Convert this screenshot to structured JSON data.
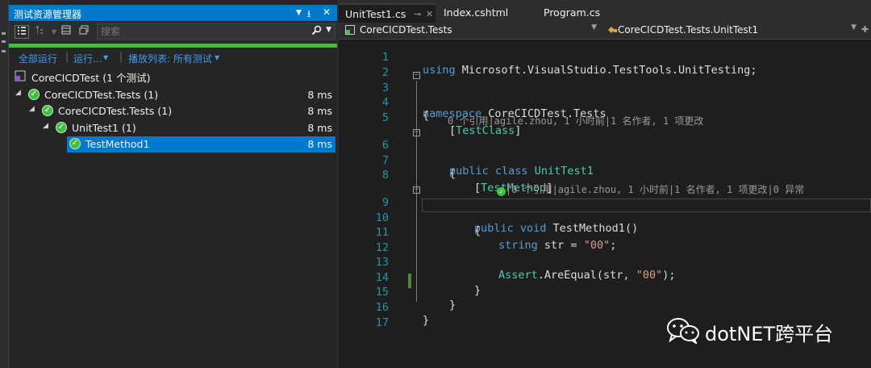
{
  "test_explorer": {
    "title": "测试资源管理器",
    "search_placeholder": "搜索",
    "actions": {
      "run_all": "全部运行",
      "run": "运行...",
      "playlist": "播放列表: 所有测试"
    },
    "root_label": "CoreCICDTest (1 个测试)",
    "tree": [
      {
        "label": "CoreCICDTest.Tests (1)",
        "time": "8 ms",
        "status": "passed"
      },
      {
        "label": "CoreCICDTest.Tests (1)",
        "time": "8 ms",
        "status": "passed"
      },
      {
        "label": "UnitTest1 (1)",
        "time": "8 ms",
        "status": "passed"
      },
      {
        "label": "TestMethod1",
        "time": "8 ms",
        "status": "passed",
        "selected": true
      }
    ]
  },
  "editor": {
    "tabs": [
      {
        "label": "UnitTest1.cs",
        "active": true
      },
      {
        "label": "Index.cshtml",
        "active": false
      },
      {
        "label": "Program.cs",
        "active": false
      }
    ],
    "nav_left": "CoreCICDTest.Tests",
    "nav_right": "CoreCICDTest.Tests.UnitTest1",
    "lines": {
      "n1": "1",
      "n2": "2",
      "n3": "3",
      "n4": "4",
      "n5": "5",
      "n6": "6",
      "n7": "7",
      "n8": "8",
      "n9": "9",
      "n10": "10",
      "n11": "11",
      "n12": "12",
      "n13": "13",
      "n14": "14",
      "n15": "15",
      "n16": "16",
      "n17": "17"
    },
    "code": {
      "l1_kw": "using",
      "l1_rest": " Microsoft.VisualStudio.TestTools.UnitTesting;",
      "l3_kw": "namespace",
      "l3_rest": " CoreCICDTest.Tests",
      "l4": "{",
      "l5_open": "[",
      "l5_attr": "TestClass",
      "l5_close": "]",
      "lens1": "0 个引用|agile.zhou, 1 小时前|1 名作者, 1 项更改",
      "l6_kw": "public class",
      "l6_type": "UnitTest1",
      "l7": "{",
      "l8_open": "[",
      "l8_attr": "TestMethod",
      "l8_close": "]",
      "lens2": "|0 个引用|agile.zhou, 1 小时前|1 名作者, 1 项更改|0 异常",
      "l9_kw": "public void",
      "l9_rest": " TestMethod1()",
      "l10": "{",
      "l11_kw": "string",
      "l11_mid": " str = ",
      "l11_str": "\"00\"",
      "l11_end": ";",
      "l13_type": "Assert",
      "l13_mid": ".AreEqual(str, ",
      "l13_str": "\"00\"",
      "l13_end": ");",
      "l14": "}",
      "l15": "}",
      "l16": "}"
    }
  },
  "watermark": "dotNET跨平台",
  "colors": {
    "accent": "#007acc",
    "pass_green": "#3fc13f",
    "keyword": "#569cd6",
    "type": "#4ec9b0",
    "string": "#d69d85",
    "line_number": "#2b91af"
  }
}
